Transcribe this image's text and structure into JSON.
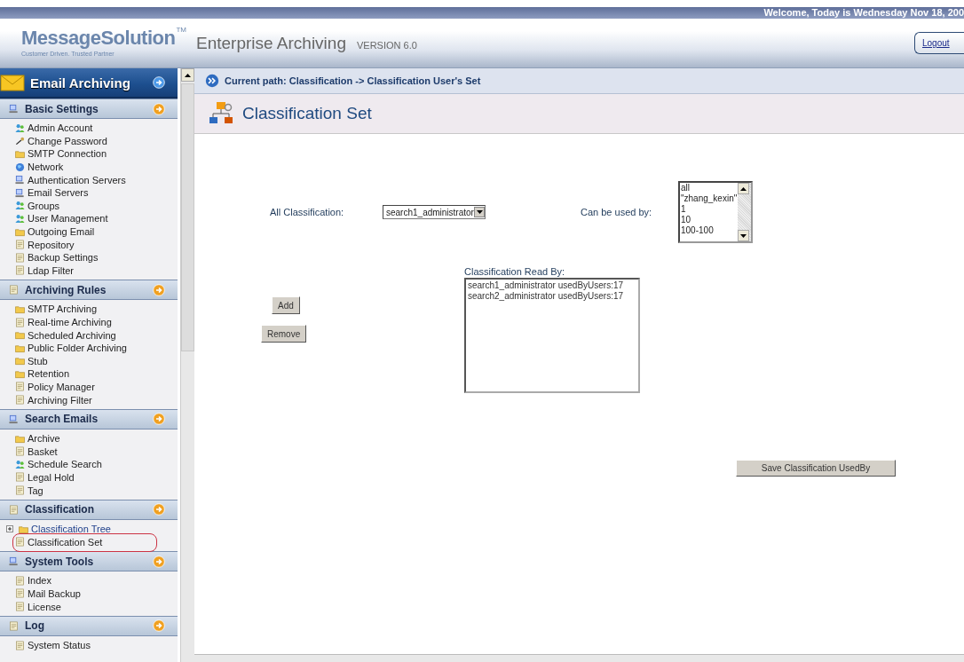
{
  "top_bar": {
    "welcome": "Welcome, Today is Wednesday Nov 18, 200"
  },
  "header": {
    "logo": "MessageSolution",
    "trademark": "TM",
    "tagline": "Customer Driven. Trusted Partner",
    "title": "Enterprise Archiving",
    "version": "VERSION 6.0",
    "logout": "Logout"
  },
  "sidebar": {
    "title": "Email Archiving",
    "sections": [
      {
        "title": "Basic Settings",
        "items": [
          {
            "label": "Admin Account",
            "kind": "link"
          },
          {
            "label": "Change Password",
            "kind": "link"
          },
          {
            "label": "SMTP Connection",
            "kind": "link"
          },
          {
            "label": "Network",
            "kind": "link"
          },
          {
            "label": "Authentication Servers",
            "kind": "link"
          },
          {
            "label": "Email Servers",
            "kind": "link"
          },
          {
            "label": "Groups",
            "kind": "link"
          },
          {
            "label": "User Management",
            "kind": "link"
          },
          {
            "label": "Outgoing Email",
            "kind": "link"
          },
          {
            "label": "Repository",
            "kind": "link"
          },
          {
            "label": "Backup Settings",
            "kind": "link"
          },
          {
            "label": "Ldap Filter",
            "kind": "link"
          }
        ]
      },
      {
        "title": "Archiving Rules",
        "items": [
          {
            "label": "SMTP Archiving",
            "kind": "link"
          },
          {
            "label": "Real-time Archiving",
            "kind": "link"
          },
          {
            "label": "Scheduled Archiving",
            "kind": "link"
          },
          {
            "label": "Public Folder Archiving",
            "kind": "link"
          },
          {
            "label": "Stub",
            "kind": "link"
          },
          {
            "label": "Retention",
            "kind": "link"
          },
          {
            "label": "Policy Manager",
            "kind": "link"
          },
          {
            "label": "Archiving Filter",
            "kind": "link"
          }
        ]
      },
      {
        "title": "Search Emails",
        "items": [
          {
            "label": "Archive",
            "kind": "link"
          },
          {
            "label": "Basket",
            "kind": "link"
          },
          {
            "label": "Schedule Search",
            "kind": "link"
          },
          {
            "label": "Legal Hold",
            "kind": "link"
          },
          {
            "label": "Tag",
            "kind": "link"
          }
        ]
      },
      {
        "title": "Classification",
        "items": [
          {
            "label": "Classification Tree",
            "kind": "tree-node",
            "expanded": false
          },
          {
            "label": "Classification Set",
            "kind": "link",
            "highlighted": true
          }
        ]
      },
      {
        "title": "System Tools",
        "items": [
          {
            "label": "Index",
            "kind": "link"
          },
          {
            "label": "Mail Backup",
            "kind": "link"
          },
          {
            "label": "License",
            "kind": "link"
          }
        ]
      },
      {
        "title": "Log",
        "items": [
          {
            "label": "System Status",
            "kind": "link"
          }
        ]
      }
    ]
  },
  "path_bar": {
    "text": "Current path: Classification -> Classification User's Set"
  },
  "page_title": "Classification Set",
  "form": {
    "all_classification": {
      "label": "All Classification:",
      "value": "search1_administrator"
    },
    "can_be_used_by": {
      "label": "Can be used by:",
      "options": [
        "all",
        "\"zhang_kexin\"",
        "1",
        "10",
        "100-100"
      ]
    },
    "read_by": {
      "label": "Classification Read By:",
      "options": [
        "search1_administrator usedByUsers:17",
        "search2_administrator usedByUsers:17"
      ]
    },
    "buttons": {
      "add": "Add",
      "remove": "Remove",
      "save": "Save Classification UsedBy"
    }
  }
}
